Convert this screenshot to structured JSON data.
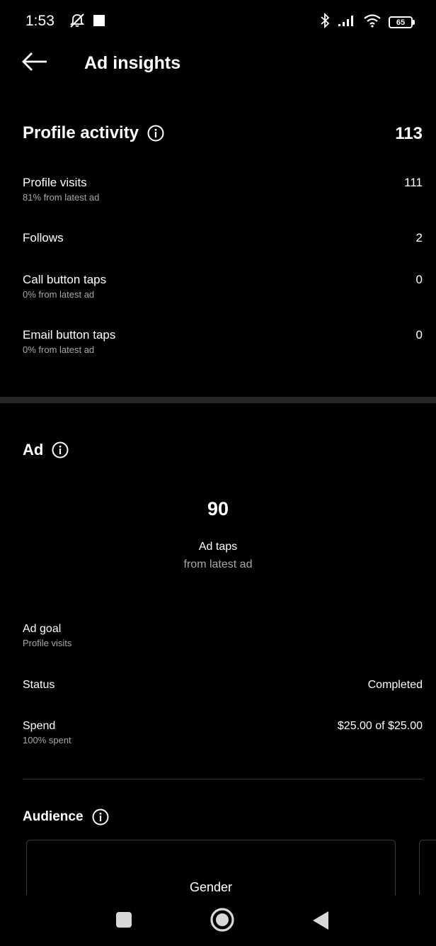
{
  "status_bar": {
    "time": "1:53",
    "battery": "65",
    "icons": [
      "silent-icon",
      "stop-icon",
      "bluetooth-icon",
      "signal-icon",
      "wifi-icon",
      "battery-icon"
    ]
  },
  "header": {
    "title": "Ad insights",
    "back_icon": "arrow-left-icon"
  },
  "profile_activity": {
    "title": "Profile activity",
    "total": "113",
    "rows": [
      {
        "label": "Profile visits",
        "sub": "81% from latest ad",
        "value": "111"
      },
      {
        "label": "Follows",
        "sub": "",
        "value": "2"
      },
      {
        "label": "Call button taps",
        "sub": "0% from latest ad",
        "value": "0"
      },
      {
        "label": "Email button taps",
        "sub": "0% from latest ad",
        "value": "0"
      }
    ]
  },
  "ad": {
    "title": "Ad",
    "taps_value": "90",
    "taps_label": "Ad taps",
    "taps_sub": "from latest ad",
    "goal_label": "Ad goal",
    "goal_value": "Profile visits",
    "status_label": "Status",
    "status_value": "Completed",
    "spend_label": "Spend",
    "spend_sub": "100% spent",
    "spend_value": "$25.00 of $25.00"
  },
  "audience": {
    "title": "Audience",
    "card_title": "Gender"
  },
  "nav": {
    "icons": [
      "recents-square-icon",
      "home-circle-icon",
      "back-triangle-icon"
    ]
  }
}
